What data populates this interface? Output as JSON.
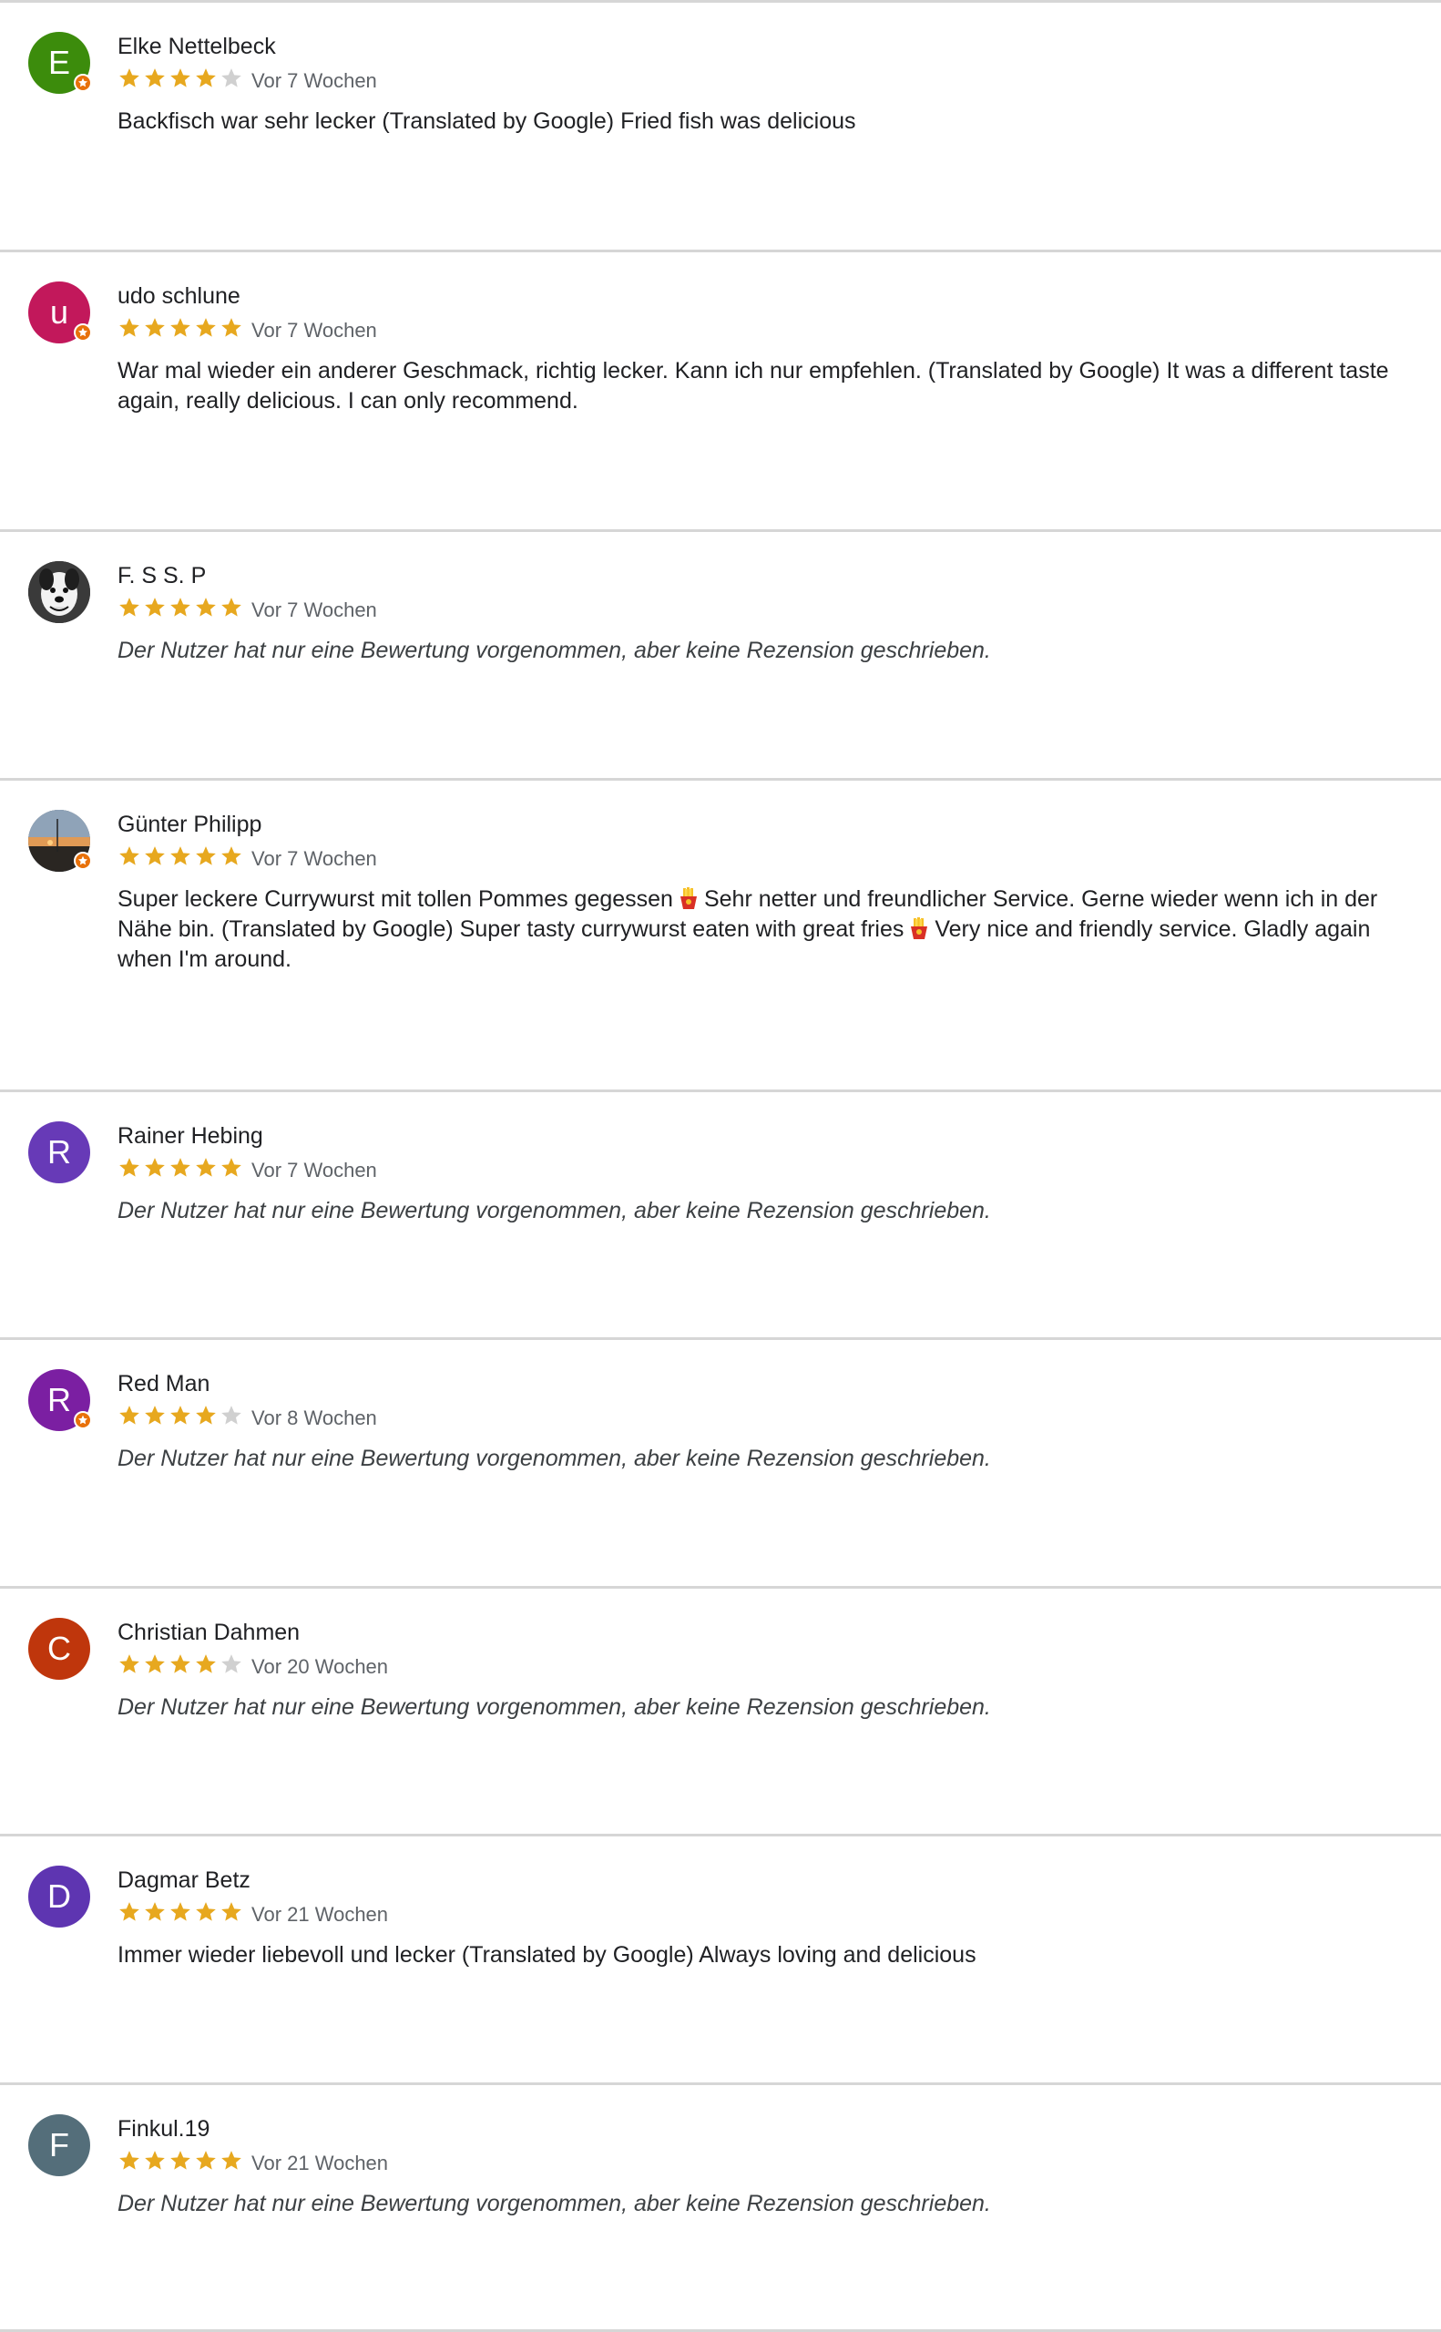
{
  "reviews": [
    {
      "name": "Elke Nettelbeck",
      "initial": "E",
      "avatar_color": "#3c8c0c",
      "local_guide": true,
      "rating": 4,
      "time": "Vor 7 Wochen",
      "text": "Backfisch war sehr lecker (Translated by Google) Fried fish was delicious"
    },
    {
      "name": "udo schlune",
      "initial": "u",
      "avatar_color": "#c2185b",
      "local_guide": true,
      "rating": 5,
      "time": "Vor 7 Wochen",
      "text": "War mal wieder ein anderer Geschmack, richtig lecker. Kann ich nur empfehlen. (Translated by Google) It was a different taste again, really delicious. I can only recommend."
    },
    {
      "name": "F. S S. P",
      "initial": "",
      "avatar_icon": "dog-photo",
      "local_guide": false,
      "rating": 5,
      "time": "Vor 7 Wochen",
      "text": "Der Nutzer hat nur eine Bewertung vorgenommen, aber keine Rezension geschrieben."
    },
    {
      "name": "Günter Philipp",
      "initial": "",
      "avatar_icon": "sunset-photo",
      "local_guide": true,
      "rating": 5,
      "time": "Vor 7 Wochen",
      "text_parts": [
        "Super leckere Currywurst mit tollen Pommes gegessen",
        "Sehr netter und freundlicher Service. Gerne wieder wenn ich in der Nähe bin. (Translated by Google) Super tasty currywurst eaten with great fries",
        "Very nice and friendly service. Gladly again when I'm around."
      ],
      "emoji": "fries-icon"
    },
    {
      "name": "Rainer Hebing",
      "initial": "R",
      "avatar_color": "#673ab7",
      "local_guide": false,
      "rating": 5,
      "time": "Vor 7 Wochen",
      "text": "Der Nutzer hat nur eine Bewertung vorgenommen, aber keine Rezension geschrieben."
    },
    {
      "name": "Red Man",
      "initial": "R",
      "avatar_color": "#7b1fa2",
      "local_guide": true,
      "rating": 4,
      "time": "Vor 8 Wochen",
      "text": "Der Nutzer hat nur eine Bewertung vorgenommen, aber keine Rezension geschrieben."
    },
    {
      "name": "Christian Dahmen",
      "initial": "C",
      "avatar_color": "#bf360c",
      "local_guide": false,
      "rating": 4,
      "time": "Vor 20 Wochen",
      "text": "Der Nutzer hat nur eine Bewertung vorgenommen, aber keine Rezension geschrieben."
    },
    {
      "name": "Dagmar Betz",
      "initial": "D",
      "avatar_color": "#5e35b1",
      "local_guide": false,
      "rating": 5,
      "time": "Vor 21 Wochen",
      "text": "Immer wieder liebevoll und lecker (Translated by Google) Always loving and delicious"
    },
    {
      "name": "Finkul.19",
      "initial": "F",
      "avatar_color": "#546e7a",
      "local_guide": false,
      "rating": 5,
      "time": "Vor 21 Wochen",
      "text": "Der Nutzer hat nur eine Bewertung vorgenommen, aber keine Rezension geschrieben."
    }
  ],
  "colors": {
    "star_filled": "#e7a81f",
    "star_empty": "#d0d0d0",
    "divider": "#d6d6d6",
    "local_guide_badge": "#e8710a"
  }
}
